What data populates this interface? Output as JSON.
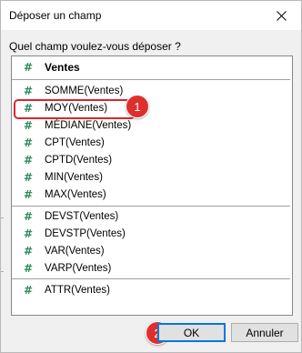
{
  "window": {
    "title": "Déposer un champ"
  },
  "prompt": "Quel champ voulez-vous déposer ?",
  "list": {
    "header": "Ventes",
    "group1": [
      "SOMME(Ventes)",
      "MOY(Ventes)",
      "MÉDIANE(Ventes)",
      "CPT(Ventes)",
      "CPTD(Ventes)",
      "MIN(Ventes)",
      "MAX(Ventes)"
    ],
    "group2": [
      "DEVST(Ventes)",
      "DEVSTP(Ventes)",
      "VAR(Ventes)",
      "VARP(Ventes)"
    ],
    "group3": [
      "ATTR(Ventes)"
    ],
    "field_icon": "#"
  },
  "annotations": {
    "badge1": "1",
    "badge2": "2",
    "accent_color": "#df2f2d"
  },
  "buttons": {
    "ok": "OK",
    "cancel": "Annuler"
  },
  "icons": {
    "close": "close-icon",
    "field": "measure-hash-icon"
  }
}
